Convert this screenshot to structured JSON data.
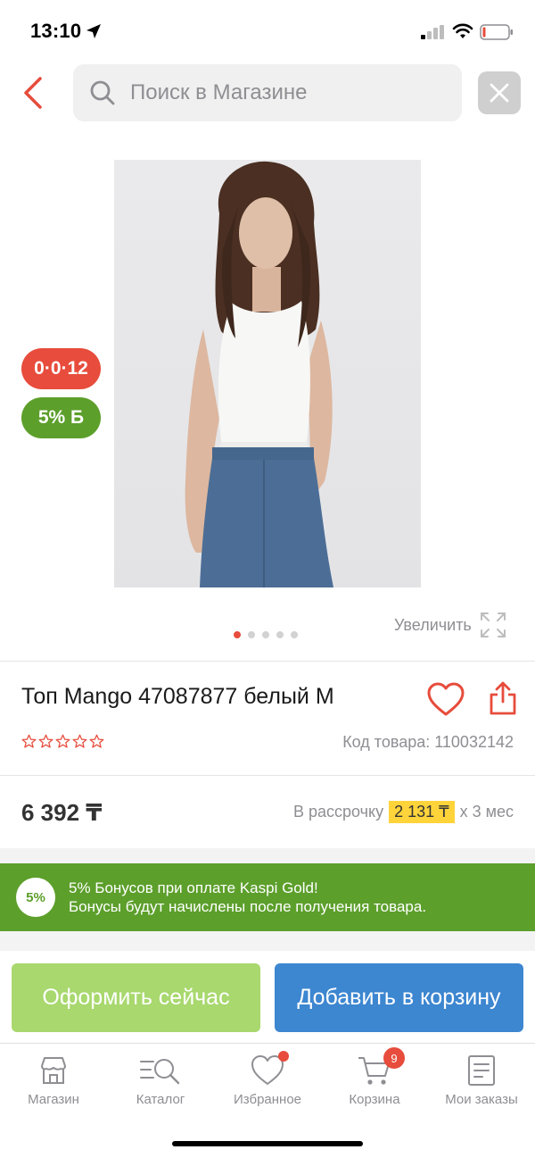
{
  "status_bar": {
    "time": "13:10"
  },
  "search": {
    "placeholder": "Поиск в Магазине"
  },
  "product": {
    "badges": {
      "installment": "0·0·12",
      "bonus": "5% Б"
    },
    "zoom_label": "Увеличить",
    "gallery": {
      "total_images": 5,
      "active_index": 0
    },
    "title": "Топ Mango 47087877 белый M",
    "rating": {
      "stars_filled": 0,
      "stars_total": 5
    },
    "code": "Код товара: 110032142",
    "price": "6 392 ₸",
    "installment": {
      "prefix": "В рассрочку",
      "amount": "2 131 ₸",
      "suffix": "x 3 мес"
    }
  },
  "bonus_banner": {
    "badge": "5%",
    "line1": "5% Бонусов при оплате Kaspi Gold!",
    "line2": "Бонусы будут начислены после получения товара."
  },
  "actions": {
    "checkout": "Оформить сейчас",
    "add_to_cart": "Добавить в корзину"
  },
  "tabbar": {
    "items": [
      {
        "label": "Магазин",
        "icon": "store-icon"
      },
      {
        "label": "Каталог",
        "icon": "catalog-icon"
      },
      {
        "label": "Избранное",
        "icon": "heart-icon"
      },
      {
        "label": "Корзина",
        "icon": "cart-icon",
        "count": "9"
      },
      {
        "label": "Мои заказы",
        "icon": "orders-icon"
      }
    ]
  },
  "colors": {
    "accent_red": "#e74c3c",
    "bonus_green": "#5c9f2b",
    "checkout_green": "#a8d86e",
    "cart_blue": "#3d86d0",
    "installment_yellow": "#ffd43b"
  }
}
